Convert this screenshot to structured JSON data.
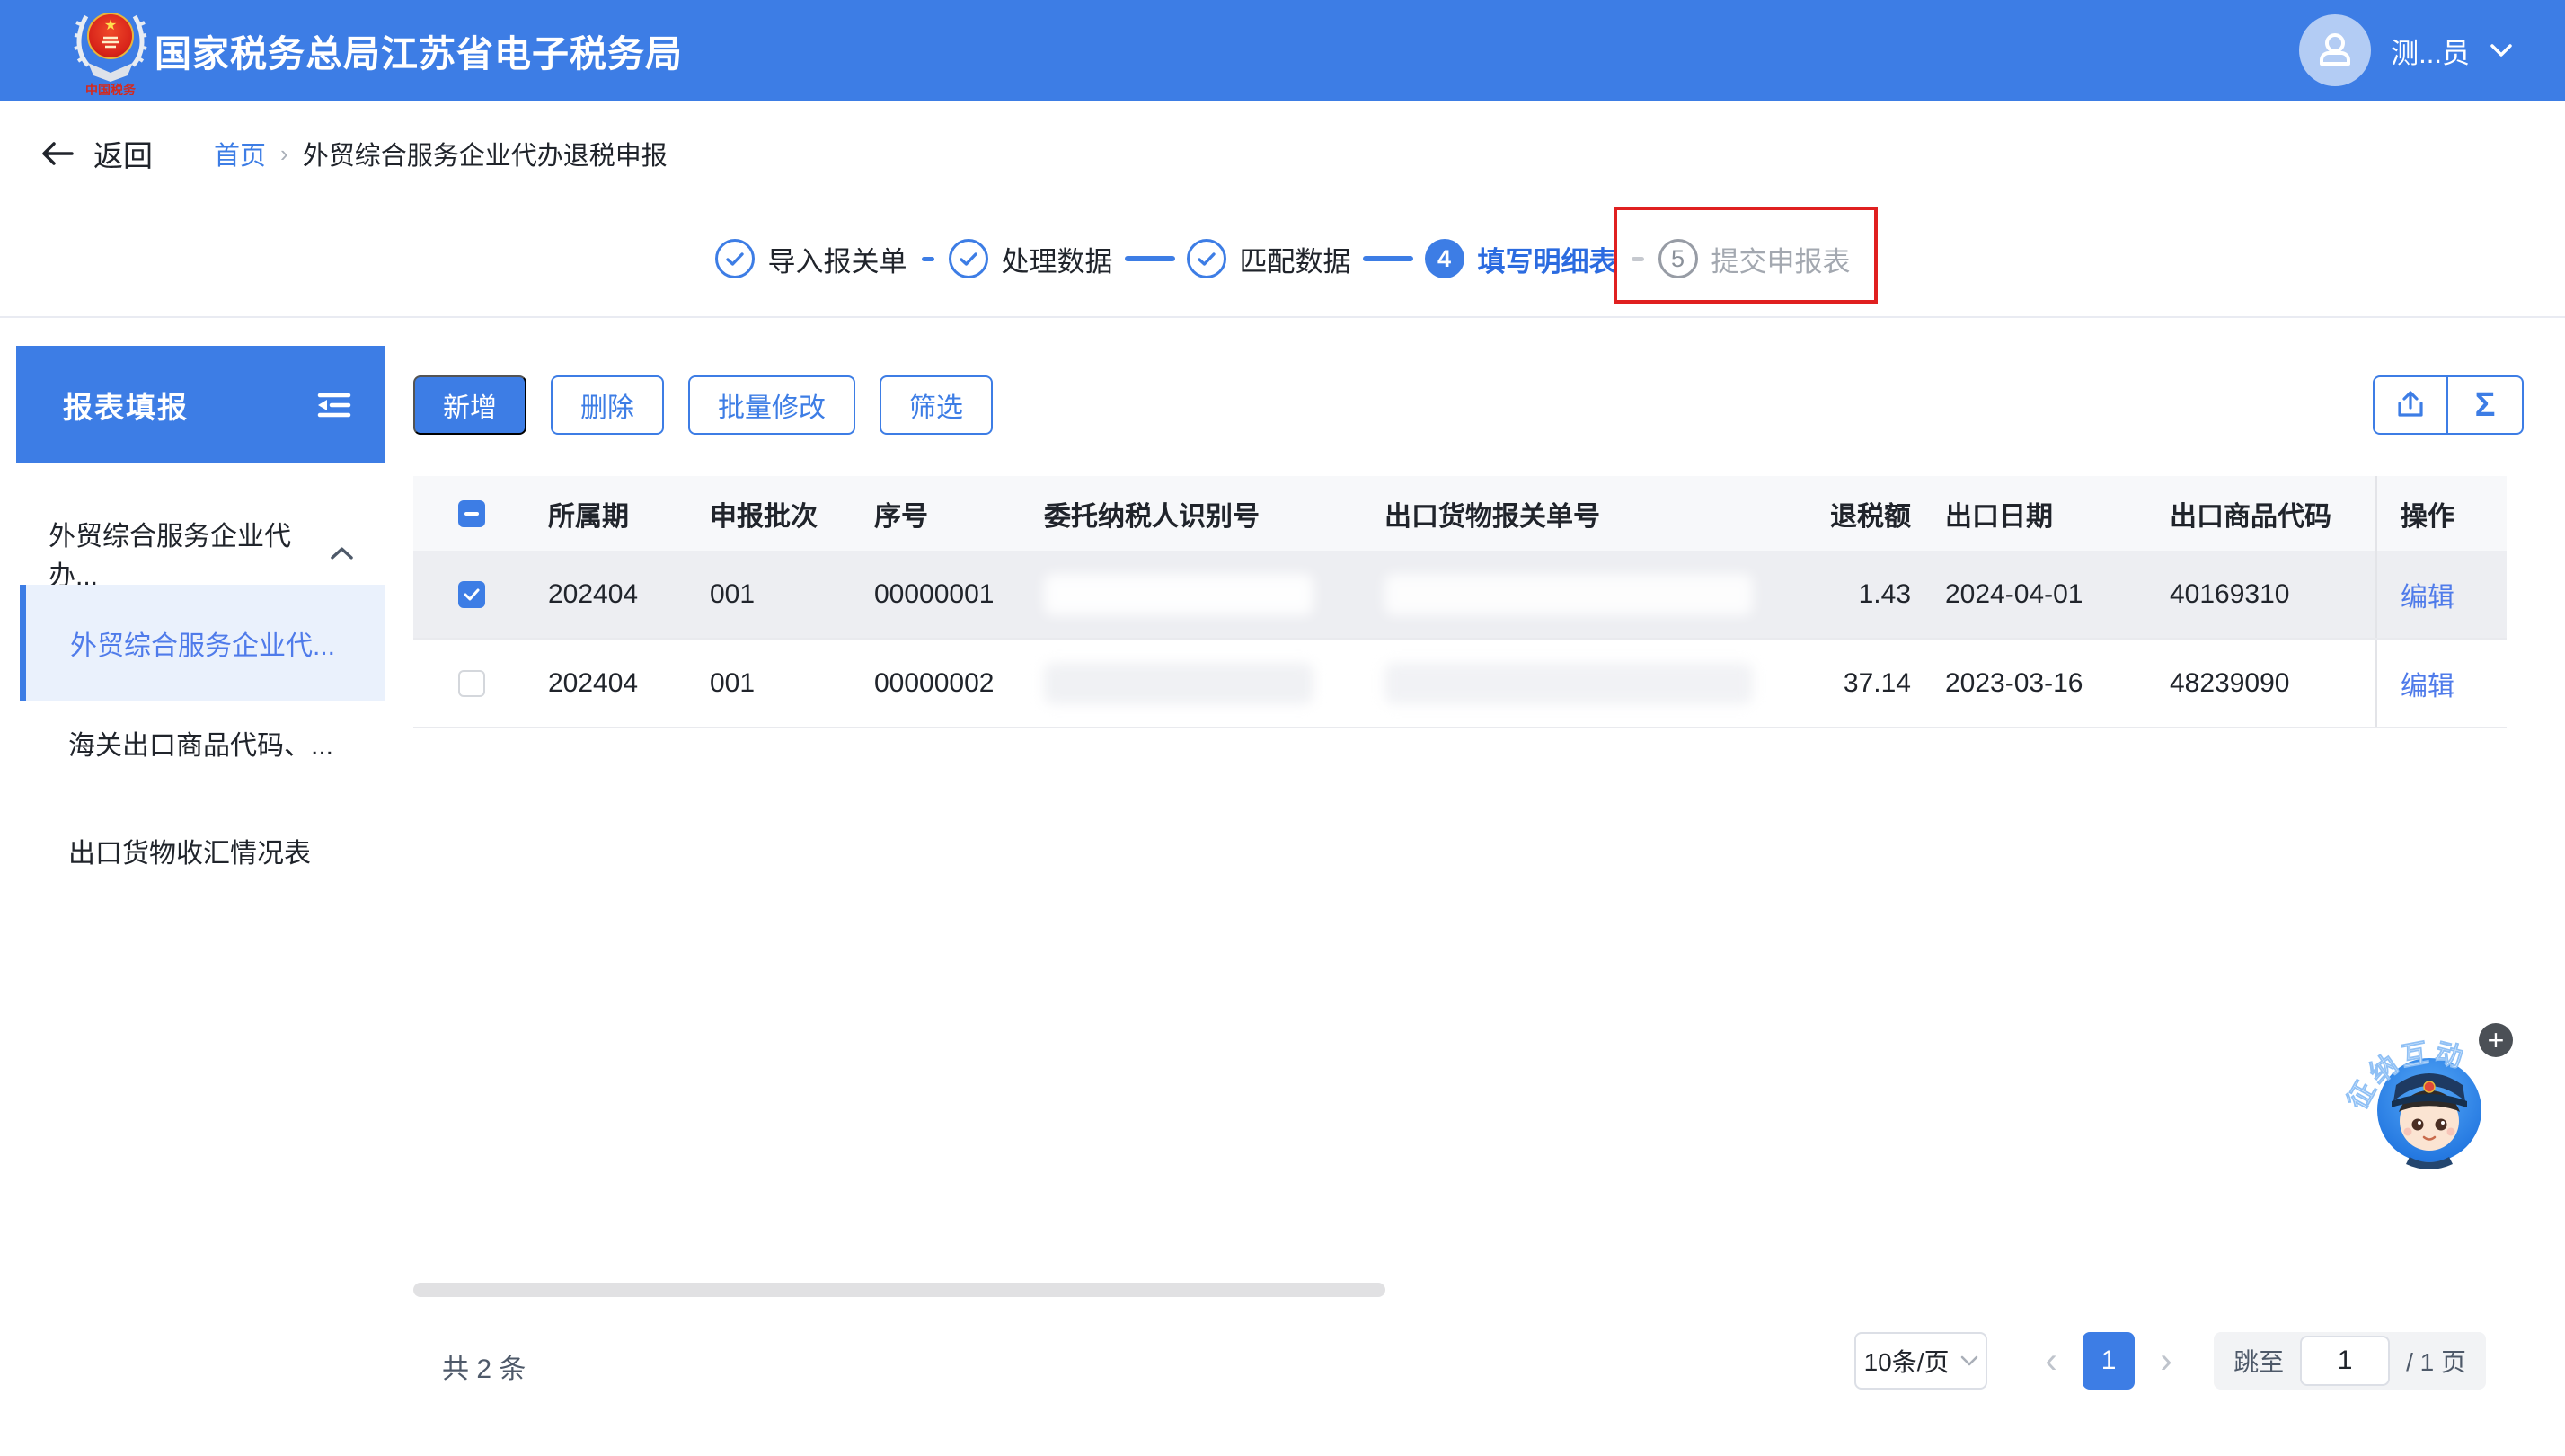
{
  "header": {
    "title": "国家税务总局江苏省电子税务局",
    "logo_caption": "中国税务",
    "user_name": "测...员"
  },
  "breadcrumb": {
    "back_label": "返回",
    "home": "首页",
    "separator": "›",
    "current": "外贸综合服务企业代办退税申报"
  },
  "steps": {
    "items": [
      {
        "label": "导入报关单",
        "state": "done"
      },
      {
        "label": "处理数据",
        "state": "done"
      },
      {
        "label": "匹配数据",
        "state": "done"
      },
      {
        "num": "4",
        "label": "填写明细表",
        "state": "current"
      },
      {
        "num": "5",
        "label": "提交申报表",
        "state": "pending",
        "highlighted": true
      }
    ]
  },
  "sidebar": {
    "title": "报表填报",
    "group_label": "外贸综合服务企业代办...",
    "group_expanded": true,
    "items": [
      {
        "label": "外贸综合服务企业代...",
        "active": true
      },
      {
        "label": "海关出口商品代码、...",
        "active": false
      },
      {
        "label": "出口货物收汇情况表",
        "active": false
      }
    ]
  },
  "toolbar": {
    "add": "新增",
    "delete": "删除",
    "batch_edit": "批量修改",
    "filter": "筛选",
    "sum_glyph": "Σ",
    "icon_buttons": [
      "export-icon",
      "sum-icon"
    ]
  },
  "table": {
    "select_all_state": "indeterminate",
    "columns": {
      "period": "所属期",
      "batch": "申报批次",
      "seq": "序号",
      "taxpayer_id": "委托纳税人识别号",
      "customs_no": "出口货物报关单号",
      "refund": "退税额",
      "export_date": "出口日期",
      "commodity_code": "出口商品代码",
      "action": "操作"
    },
    "rows": [
      {
        "checked": true,
        "period": "202404",
        "batch": "001",
        "seq": "00000001",
        "taxpayer_id": "",
        "customs_no": "",
        "refund": "1.43",
        "export_date": "2024-04-01",
        "commodity_code": "40169310",
        "action": "编辑",
        "redacted": true
      },
      {
        "checked": false,
        "period": "202404",
        "batch": "001",
        "seq": "00000002",
        "taxpayer_id": "",
        "customs_no": "",
        "refund": "37.14",
        "export_date": "2023-03-16",
        "commodity_code": "48239090",
        "action": "编辑",
        "redacted": true
      }
    ]
  },
  "pagination": {
    "total": "共 2 条",
    "page_size": "10条/页",
    "prev": "‹",
    "current_page": "1",
    "next": "›",
    "jump_label": "跳至",
    "jump_value": "1",
    "pages_suffix": "/ 1 页"
  },
  "floating": {
    "mascot_label": "征纳互动",
    "badge": "+"
  },
  "colors": {
    "primary_blue": "#3D7DE5",
    "current_step_label": "#2B6BE0",
    "link_blue": "#4F7BEA",
    "highlight_red": "#E02020",
    "pending_gray": "#A3A8B0",
    "selected_row_bg": "#EDEEF2",
    "table_header_bg": "#F7F8FA"
  }
}
